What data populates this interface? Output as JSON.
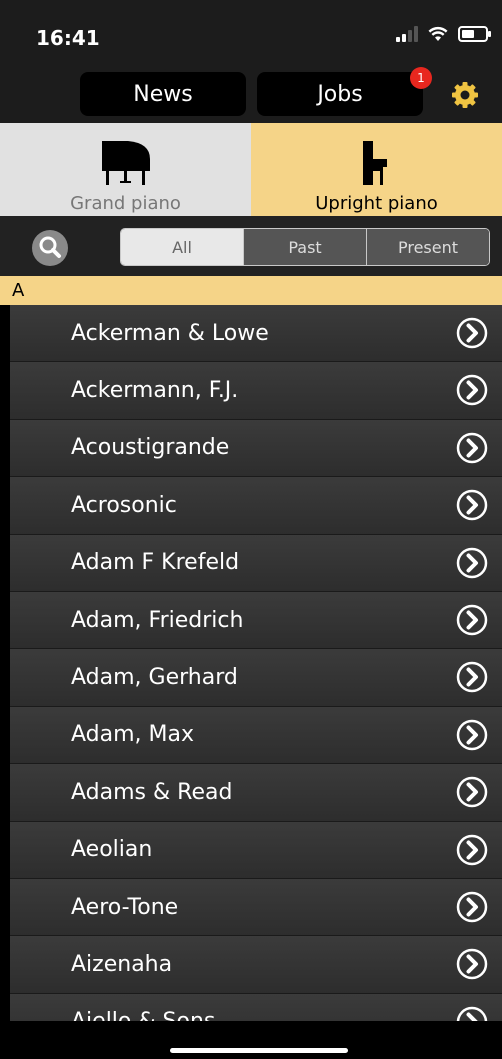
{
  "status_bar": {
    "time": "16:41"
  },
  "nav": {
    "news_label": "News",
    "jobs_label": "Jobs",
    "jobs_badge": "1"
  },
  "piano_types": [
    {
      "label": "Grand piano",
      "selected": false
    },
    {
      "label": "Upright piano",
      "selected": true
    }
  ],
  "filters": {
    "segments": [
      "All",
      "Past",
      "Present"
    ],
    "selected": "All"
  },
  "section_header": "A",
  "list": {
    "items": [
      "Ackerman & Lowe",
      "Ackermann, F.J.",
      "Acoustigrande",
      "Acrosonic",
      "Adam F Krefeld",
      "Adam, Friedrich",
      "Adam, Gerhard",
      "Adam, Max",
      "Adams & Read",
      "Aeolian",
      "Aero-Tone",
      "Aizenaha",
      "Aiello & Sons"
    ]
  },
  "colors": {
    "accent": "#f5d488",
    "badge": "#e8271f",
    "row": "#353535"
  }
}
